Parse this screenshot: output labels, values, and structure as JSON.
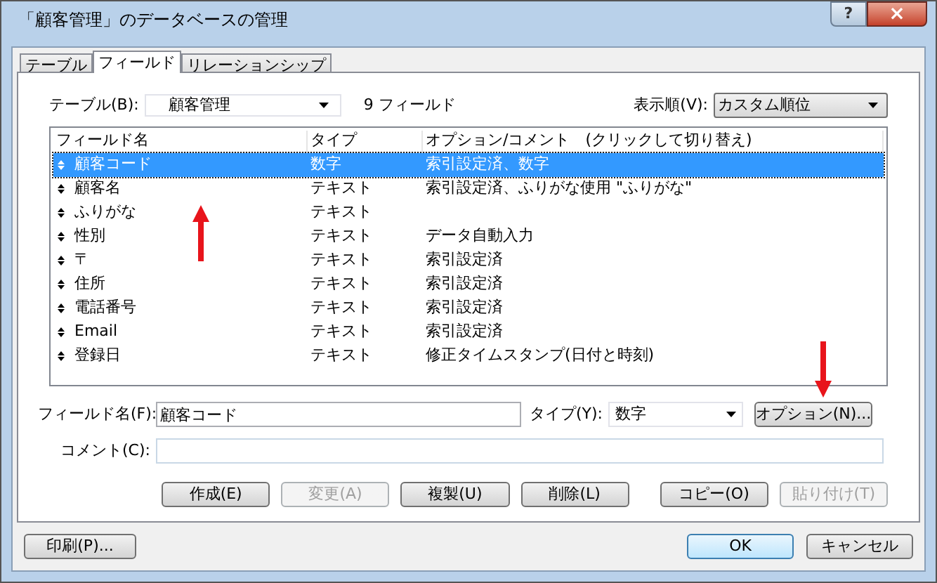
{
  "window": {
    "title": "「顧客管理」のデータベースの管理",
    "help": "?",
    "close": "×"
  },
  "tabs": [
    {
      "label": "テーブル",
      "selected": false
    },
    {
      "label": "フィールド",
      "selected": true
    },
    {
      "label": "リレーションシップ",
      "selected": false
    }
  ],
  "table_select": {
    "label": "テーブル(B):",
    "value": "顧客管理"
  },
  "field_count": "9 フィールド",
  "sort_select": {
    "label": "表示順(V):",
    "value": "カスタム順位"
  },
  "list": {
    "columns": [
      "フィールド名",
      "タイプ",
      "オプション/コメント　(クリックして切り替え)"
    ],
    "rows": [
      {
        "name": "顧客コード",
        "type": "数字",
        "options": "索引設定済、数字",
        "selected": true
      },
      {
        "name": "顧客名",
        "type": "テキスト",
        "options": "索引設定済、ふりがな使用 \"ふりがな\"",
        "selected": false
      },
      {
        "name": "ふりがな",
        "type": "テキスト",
        "options": "",
        "selected": false
      },
      {
        "name": "性別",
        "type": "テキスト",
        "options": "データ自動入力",
        "selected": false
      },
      {
        "name": "〒",
        "type": "テキスト",
        "options": "索引設定済",
        "selected": false
      },
      {
        "name": "住所",
        "type": "テキスト",
        "options": "索引設定済",
        "selected": false
      },
      {
        "name": "電話番号",
        "type": "テキスト",
        "options": "索引設定済",
        "selected": false
      },
      {
        "name": "Email",
        "type": "テキスト",
        "options": "索引設定済",
        "selected": false
      },
      {
        "name": "登録日",
        "type": "テキスト",
        "options": "修正タイムスタンプ(日付と時刻)",
        "selected": false
      }
    ]
  },
  "field_name": {
    "label": "フィールド名(F):",
    "value": "顧客コード"
  },
  "type_select": {
    "label": "タイプ(Y):",
    "value": "数字"
  },
  "options_button": {
    "label": "オプション(N)...",
    "disabled": false
  },
  "comment": {
    "label": "コメント(C):"
  },
  "action_buttons": [
    {
      "label": "作成(E)",
      "disabled": false
    },
    {
      "label": "変更(A)",
      "disabled": true
    },
    {
      "label": "複製(U)",
      "disabled": false
    },
    {
      "label": "削除(L)",
      "disabled": false
    },
    {
      "label": "コピー(O)",
      "disabled": false
    },
    {
      "label": "貼り付け(T)",
      "disabled": true
    }
  ],
  "print_button": {
    "label": "印刷(P)...",
    "disabled": false
  },
  "dialog_buttons": [
    {
      "label": "OK",
      "disabled": false,
      "kind": "default"
    },
    {
      "label": "キャンセル",
      "disabled": false,
      "kind": "normal"
    }
  ]
}
